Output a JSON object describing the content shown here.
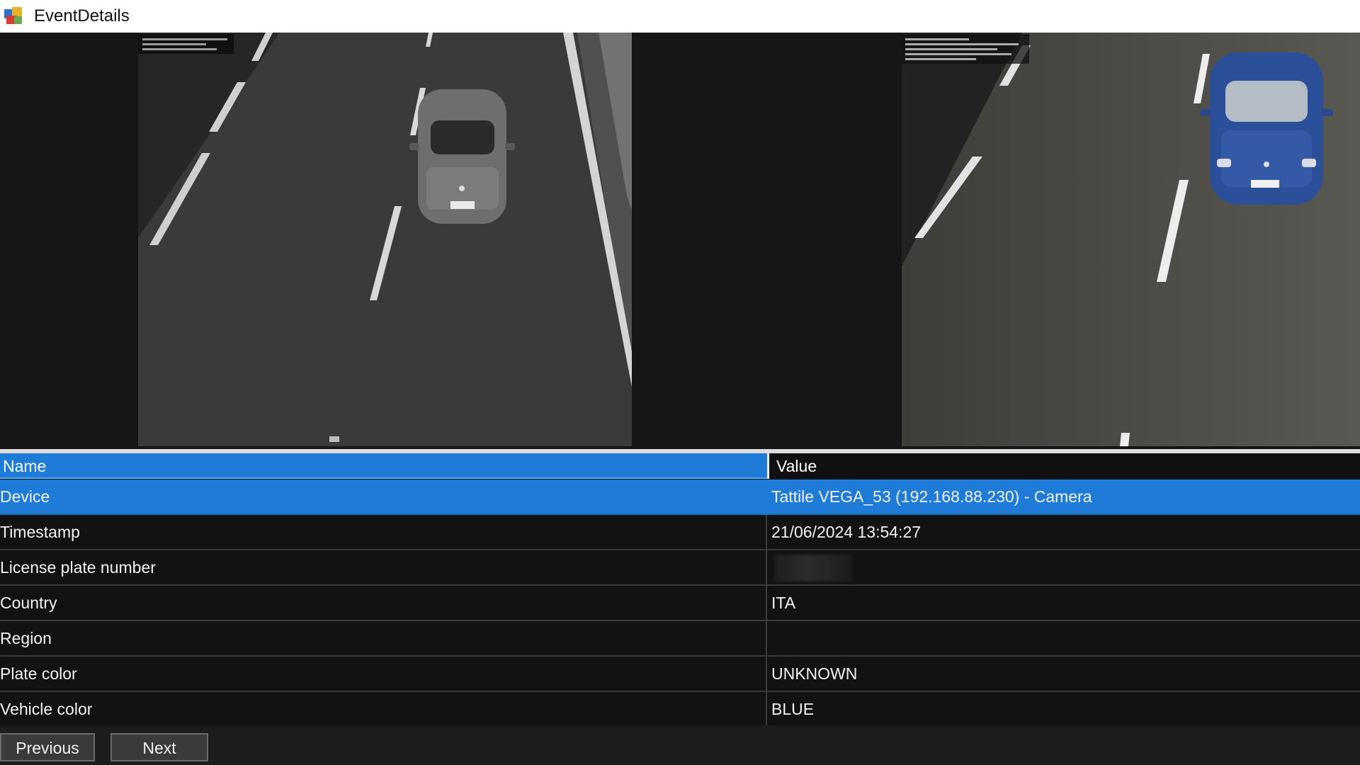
{
  "window": {
    "title": "EventDetails",
    "icon": "app-window-icon"
  },
  "grid": {
    "headers": {
      "name": "Name",
      "value": "Value"
    },
    "rows": [
      {
        "name": "Device",
        "value": "Tattile VEGA_53 (192.168.88.230) - Camera",
        "selected": true
      },
      {
        "name": "Timestamp",
        "value": "21/06/2024 13:54:27"
      },
      {
        "name": "License plate number",
        "value": ""
      },
      {
        "name": "Country",
        "value": "ITA"
      },
      {
        "name": "Region",
        "value": ""
      },
      {
        "name": "Plate color",
        "value": "UNKNOWN"
      },
      {
        "name": "Vehicle color",
        "value": "BLUE"
      }
    ]
  },
  "buttons": {
    "previous": "Previous",
    "next": "Next"
  },
  "colors": {
    "selection": "#1e7bd8",
    "background": "#121212",
    "vehicle": "#2c4f9a"
  }
}
